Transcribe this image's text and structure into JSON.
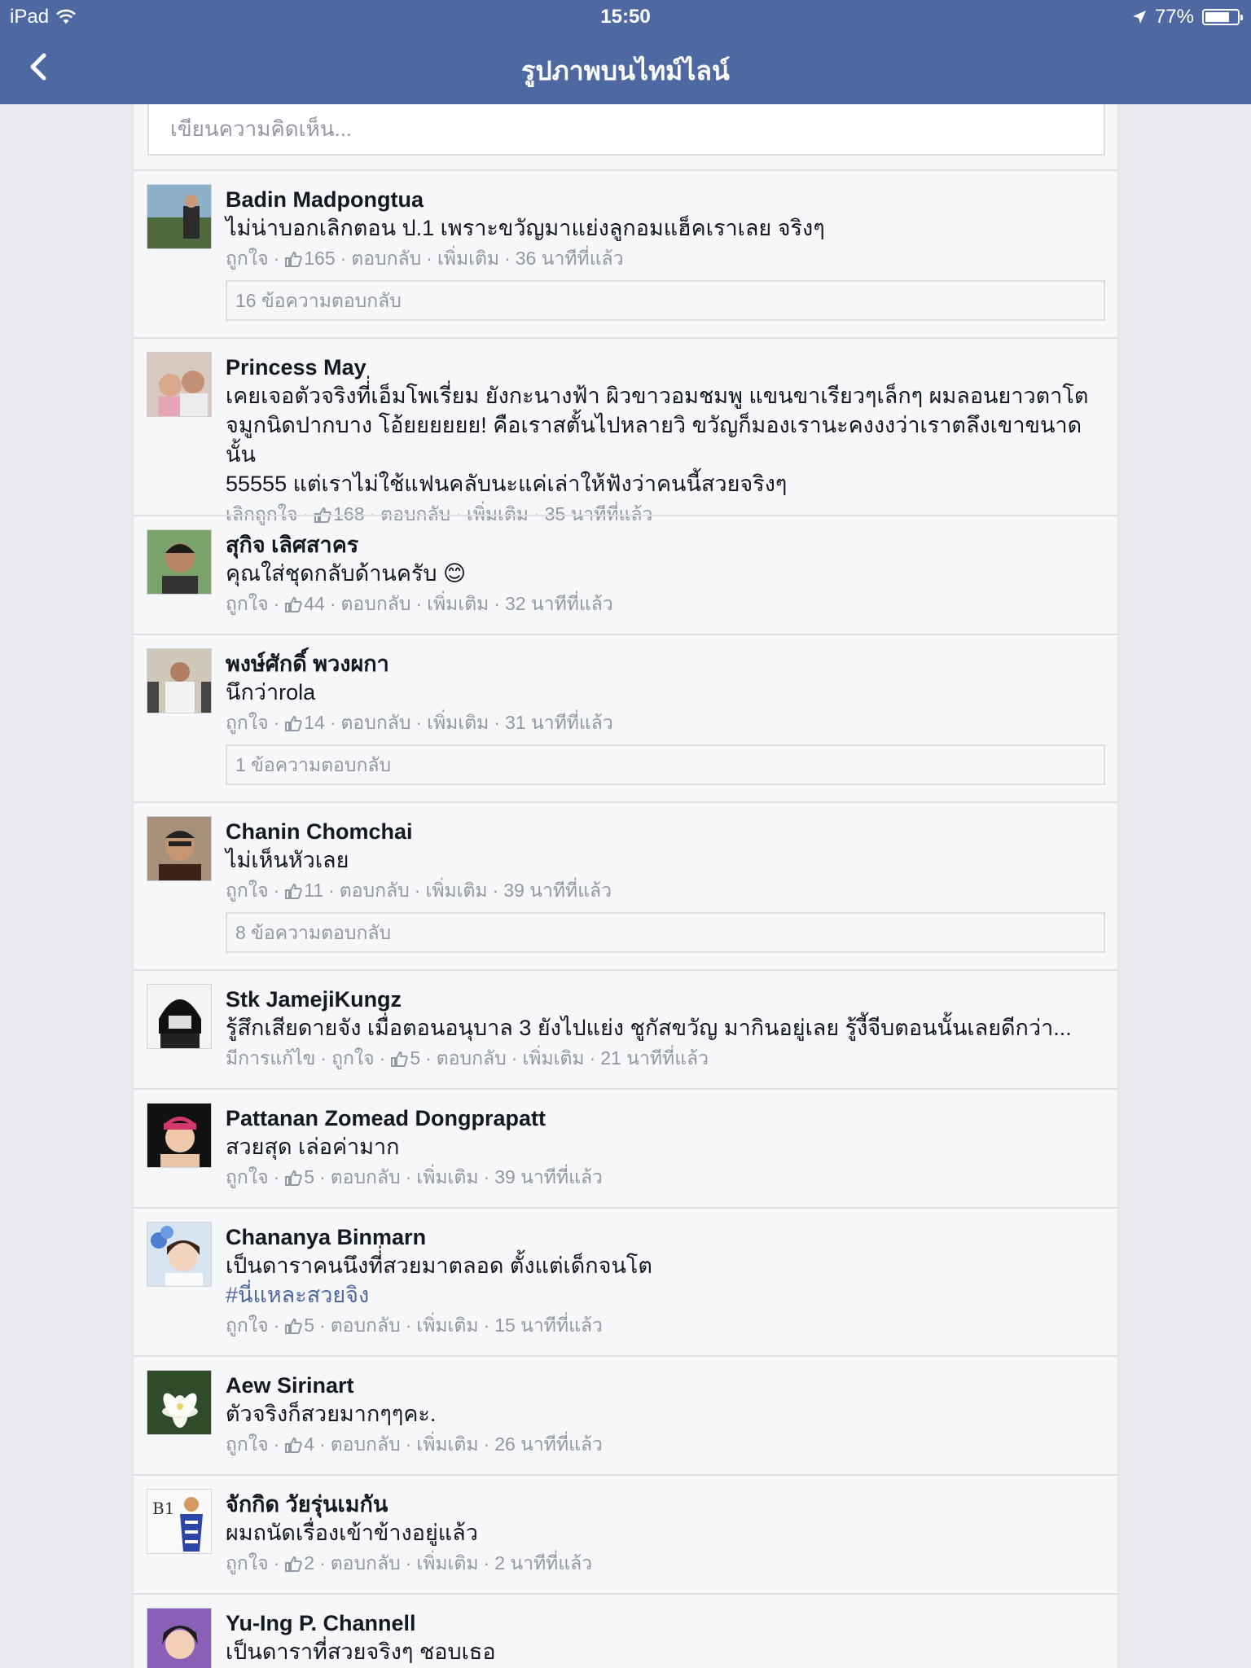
{
  "status": {
    "device": "iPad",
    "time": "15:50",
    "battery": "77%",
    "battery_level": 0.77
  },
  "nav": {
    "title": "รูปภาพบนไทม์ไลน์"
  },
  "composer": {
    "placeholder": "เขียนความคิดเห็น..."
  },
  "comments": [
    {
      "author": "Badin Madpongtua",
      "text": "ไม่น่าบอกเลิกตอน ป.1 เพราะขวัญมาแย่งลูกอมแฮ็คเราเลย จริงๆ",
      "prefix": "",
      "like": "ถูกใจ",
      "likes": "165",
      "reply": "ตอบกลับ",
      "more": "เพิ่มเติม",
      "time": "36 นาทีที่แล้ว",
      "replies": "16 ข้อความตอบกลับ"
    },
    {
      "author": "Princess May",
      "text": "เคยเจอตัวจริงที่่เอ็มโพเรี่ยม ยังกะนางฟ้า ผิวขาวอมชมพู แขนขาเรียวๆเล็กๆ ผมลอนยาวตาโต\nจมูกนิดปากบาง โอ้ยยยยยย! คือเราสตั้นไปหลายวิ ขวัญก็มองเรานะคงงงว่าเราตลึงเขาขนาดนั้น\n55555 แต่เราไม่ใช้แฟนคลับนะแค่เล่าให้ฟังว่าคนนี้สวยจริงๆ",
      "prefix": "",
      "like": "เลิกถูกใจ",
      "likes": "168",
      "reply": "ตอบกลับ",
      "more": "เพิ่มเติม",
      "time": "35 นาทีที่แล้ว"
    },
    {
      "author": "สุกิจ เลิศสาคร",
      "text": "คุณใส่ชุดกลับด้านครับ 😊",
      "prefix": "",
      "like": "ถูกใจ",
      "likes": "44",
      "reply": "ตอบกลับ",
      "more": "เพิ่มเติม",
      "time": "32 นาทีที่แล้ว"
    },
    {
      "author": "พงษ์ศักดิ์ พวงผกา",
      "text": "นึกว่าrola",
      "prefix": "",
      "like": "ถูกใจ",
      "likes": "14",
      "reply": "ตอบกลับ",
      "more": "เพิ่มเติม",
      "time": "31 นาทีที่แล้ว",
      "replies": "1 ข้อความตอบกลับ"
    },
    {
      "author": "Chanin Chomchai",
      "text": "ไม่เห็นหัวเลย",
      "prefix": "",
      "like": "ถูกใจ",
      "likes": "11",
      "reply": "ตอบกลับ",
      "more": "เพิ่มเติม",
      "time": "39 นาทีที่แล้ว",
      "replies": "8 ข้อความตอบกลับ"
    },
    {
      "author": "Stk JamejiKungz",
      "text": "รู้สึกเสียดายจัง เมื่อตอนอนุบาล 3 ยังไปแย่ง ชูกัสขวัญ มากินอยู่เลย รู้งี้จีบตอนนั้นเลยดีกว่า...",
      "prefix": "มีการแก้ไข",
      "like": "ถูกใจ",
      "likes": "5",
      "reply": "ตอบกลับ",
      "more": "เพิ่มเติม",
      "time": "21 นาทีที่แล้ว"
    },
    {
      "author": "Pattanan Zomead Dongprapatt",
      "text": "สวยสุด เล่อค่ามาก",
      "prefix": "",
      "like": "ถูกใจ",
      "likes": "5",
      "reply": "ตอบกลับ",
      "more": "เพิ่มเติม",
      "time": "39 นาทีที่แล้ว"
    },
    {
      "author": "Chananya Binmarn",
      "text": "เป็นดาราคนนึงที่่สวยมาตลอด ตั้งแต่เด็กจนโต",
      "hashtag": "#นี่แหละสวยจิง",
      "prefix": "",
      "like": "ถูกใจ",
      "likes": "5",
      "reply": "ตอบกลับ",
      "more": "เพิ่มเติม",
      "time": "15 นาทีที่แล้ว"
    },
    {
      "author": "Aew Sirinart",
      "text": "ตัวจริงก็สวยมากๆๆคะ.",
      "prefix": "",
      "like": "ถูกใจ",
      "likes": "4",
      "reply": "ตอบกลับ",
      "more": "เพิ่มเติม",
      "time": "26 นาทีที่แล้ว"
    },
    {
      "author": "จักกิด วัยรุ่นเมกัน",
      "text": "ผมถนัดเรื่องเข้าข้างอยู่แล้ว",
      "prefix": "",
      "like": "ถูกใจ",
      "likes": "2",
      "reply": "ตอบกลับ",
      "more": "เพิ่มเติม",
      "time": "2 นาทีที่แล้ว",
      "avatar_text": "B1"
    },
    {
      "author": "Yu-Ing P. Channell",
      "text": "เป็นดาราที่สวยจริงๆ ชอบเธอ"
    }
  ]
}
